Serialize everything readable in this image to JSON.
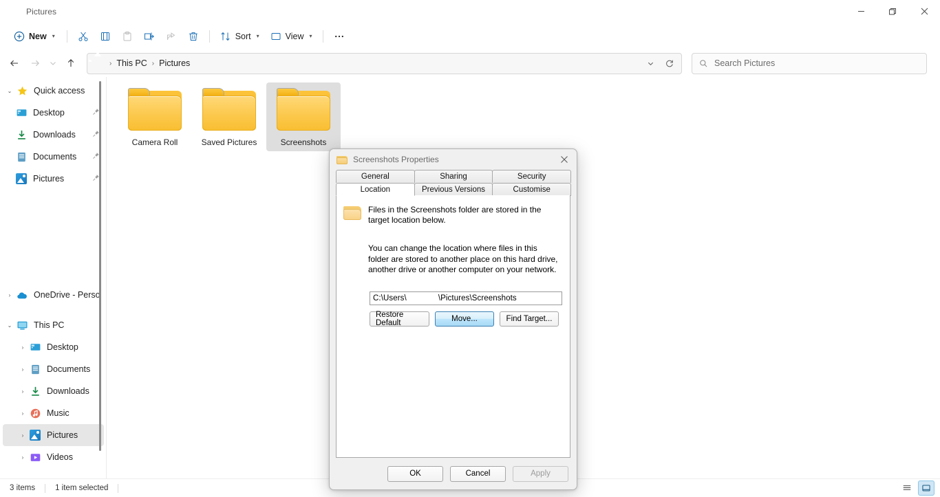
{
  "window": {
    "title": "Pictures",
    "icon": "pictures-icon",
    "minimize": "—",
    "maximize": "❐",
    "close": "✕"
  },
  "toolbar": {
    "new_label": "New",
    "cut_label": "Cut",
    "copy_label": "Copy",
    "paste_label": "Paste",
    "rename_label": "Rename",
    "share_label": "Share",
    "delete_label": "Delete",
    "sort_label": "Sort",
    "view_label": "View",
    "more_label": "See more"
  },
  "navigation": {
    "back": "Back",
    "forward": "Forward",
    "recent": "Recent locations",
    "up": "Up to This PC",
    "breadcrumbs": [
      "This PC",
      "Pictures"
    ],
    "separator": "›",
    "dropdown": "Previous locations",
    "refresh": "Refresh"
  },
  "search": {
    "placeholder": "Search Pictures",
    "icon": "search-icon"
  },
  "sidebar": {
    "sections": [
      {
        "label": "Quick access",
        "icon": "star-icon",
        "expanded": true,
        "items": [
          {
            "label": "Desktop",
            "icon": "desktop-icon",
            "pinned": true
          },
          {
            "label": "Downloads",
            "icon": "downloads-icon",
            "pinned": true
          },
          {
            "label": "Documents",
            "icon": "documents-icon",
            "pinned": true
          },
          {
            "label": "Pictures",
            "icon": "pictures-icon",
            "pinned": true
          }
        ]
      },
      {
        "label": "OneDrive - Perso",
        "icon": "onedrive-icon",
        "expanded": false,
        "items": []
      },
      {
        "label": "This PC",
        "icon": "thispc-icon",
        "expanded": true,
        "items": [
          {
            "label": "Desktop",
            "icon": "desktop-icon",
            "pinned": false
          },
          {
            "label": "Documents",
            "icon": "documents-icon",
            "pinned": false
          },
          {
            "label": "Downloads",
            "icon": "downloads-icon",
            "pinned": false
          },
          {
            "label": "Music",
            "icon": "music-icon",
            "pinned": false
          },
          {
            "label": "Pictures",
            "icon": "pictures-icon",
            "pinned": false,
            "selected": true
          },
          {
            "label": "Videos",
            "icon": "videos-icon",
            "pinned": false
          }
        ]
      }
    ],
    "expand_collapsed": "›",
    "expand_open": "⌄",
    "pin_glyph": "📌"
  },
  "files": [
    {
      "name": "Camera Roll",
      "type": "folder",
      "selected": false
    },
    {
      "name": "Saved Pictures",
      "type": "folder",
      "selected": false
    },
    {
      "name": "Screenshots",
      "type": "folder",
      "selected": true
    }
  ],
  "status": {
    "item_count": "3 items",
    "selection": "1 item selected",
    "view_list": "List view",
    "view_details": "Details pane"
  },
  "dialog": {
    "title": "Screenshots Properties",
    "close_label": "✕",
    "tabs_row1": [
      {
        "label": "General",
        "active": false
      },
      {
        "label": "Sharing",
        "active": false
      },
      {
        "label": "Security",
        "active": false
      }
    ],
    "tabs_row2": [
      {
        "label": "Location",
        "active": true
      },
      {
        "label": "Previous Versions",
        "active": false
      },
      {
        "label": "Customise",
        "active": false
      }
    ],
    "location": {
      "heading": "Files in the Screenshots folder are stored in the target location below.",
      "description": "You can change the location where files in this folder are stored to another place on this hard drive, another drive or another computer on your network.",
      "path_prefix": "C:\\Users\\",
      "path_suffix": "\\Pictures\\Screenshots",
      "buttons": [
        {
          "label": "Restore Default",
          "focused": false,
          "disabled": false
        },
        {
          "label": "Move...",
          "focused": true,
          "disabled": false
        },
        {
          "label": "Find Target...",
          "focused": false,
          "disabled": false
        }
      ]
    },
    "footer": [
      {
        "label": "OK",
        "disabled": false
      },
      {
        "label": "Cancel",
        "disabled": false
      },
      {
        "label": "Apply",
        "disabled": true
      }
    ]
  },
  "colors": {
    "accent": "#0078d4",
    "folder": "#fcc94d",
    "selection": "#dedede",
    "focus_blue": "#3c7fb1"
  }
}
